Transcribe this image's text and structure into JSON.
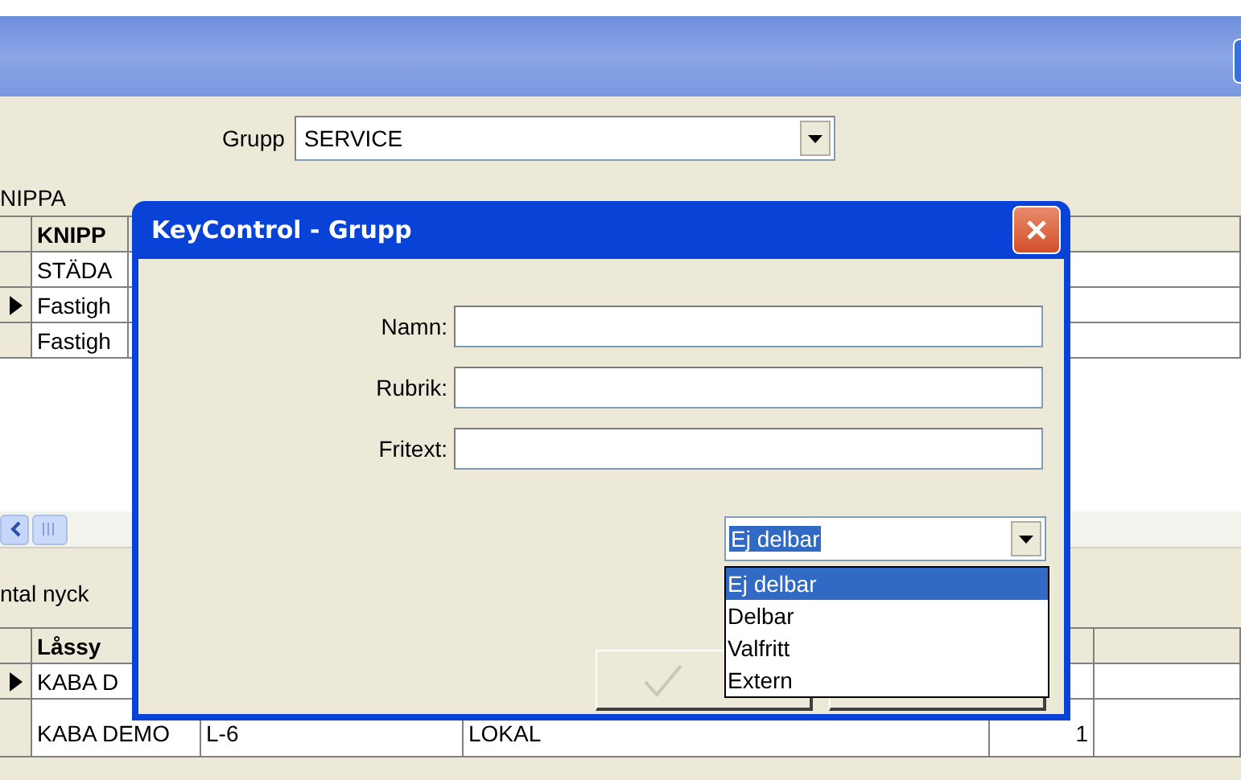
{
  "filter": {
    "label": "Grupp",
    "value": "SERVICE"
  },
  "keyring_section": {
    "label": "NIPPA",
    "columns": [
      "KNIPP"
    ],
    "rows": [
      {
        "cells": [
          "STÄDA"
        ],
        "selected": false
      },
      {
        "cells": [
          "Fastigh"
        ],
        "selected": true
      },
      {
        "cells": [
          "Fastigh"
        ],
        "selected": false
      }
    ]
  },
  "keys_section": {
    "label": "ntal nyck",
    "columns": [
      "Låssy"
    ],
    "rows": [
      {
        "cells": [
          "KABA D"
        ],
        "selected": true
      },
      {
        "cells": [
          "KABA DEMO",
          "L-6",
          "LOKAL",
          "1"
        ],
        "selected": false
      }
    ]
  },
  "dialog": {
    "title": "KeyControl - Grupp",
    "fields": [
      {
        "label": "Namn:"
      },
      {
        "label": "Rubrik:"
      },
      {
        "label": "Fritext:"
      }
    ],
    "type_select": {
      "value": "Ej delbar",
      "expanded": true,
      "options": [
        {
          "label": "Ej delbar",
          "selected": true
        },
        {
          "label": "Delbar",
          "selected": false
        },
        {
          "label": "Valfritt",
          "selected": false
        },
        {
          "label": "Extern",
          "selected": false
        }
      ]
    }
  }
}
